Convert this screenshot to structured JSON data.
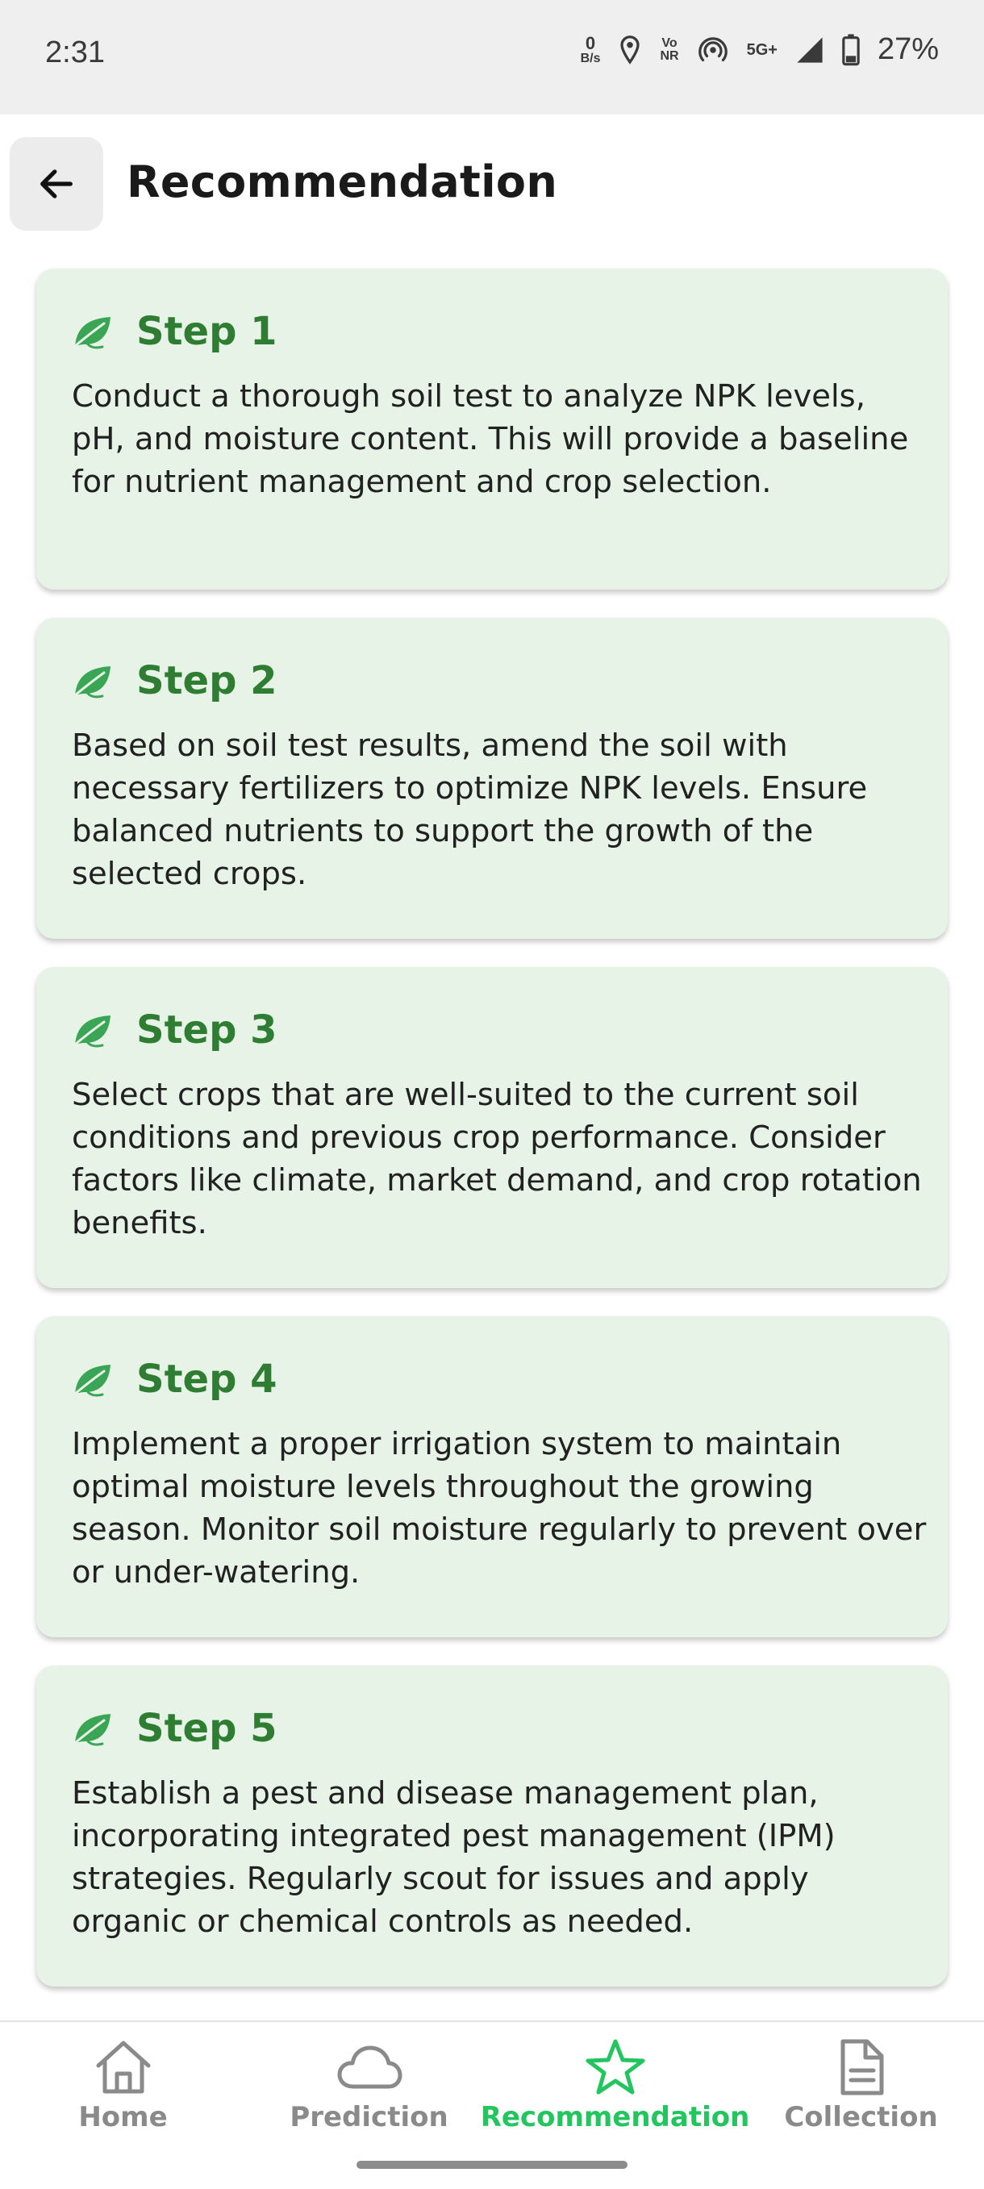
{
  "status_bar": {
    "time": "2:31",
    "data_rate_value": "0",
    "data_rate_unit": "B/s",
    "volte_top": "Vo",
    "volte_bottom": "NR",
    "network": "5G+",
    "battery": "27%"
  },
  "header": {
    "title": "Recommendation"
  },
  "steps": [
    {
      "title": "Step 1",
      "text": "Conduct a thorough soil test to analyze NPK levels, pH, and moisture content. This will provide a baseline for nutrient management and crop selection."
    },
    {
      "title": "Step 2",
      "text": "Based on soil test results, amend the soil with necessary fertilizers to optimize NPK levels. Ensure balanced nutrients to support the growth of the selected crops."
    },
    {
      "title": "Step 3",
      "text": "Select crops that are well-suited to the current soil conditions and previous crop performance. Consider factors like climate, market demand, and crop rotation benefits."
    },
    {
      "title": "Step 4",
      "text": "Implement a proper irrigation system to maintain optimal moisture levels throughout the growing season. Monitor soil moisture regularly to prevent over or under-watering."
    },
    {
      "title": "Step 5",
      "text": "Establish a pest and disease management plan, incorporating integrated pest management (IPM) strategies. Regularly scout for issues and apply organic or chemical controls as needed."
    }
  ],
  "bottom_nav": {
    "items": [
      {
        "label": "Home",
        "icon": "home-icon"
      },
      {
        "label": "Prediction",
        "icon": "cloud-icon"
      },
      {
        "label": "Recommendation",
        "icon": "star-icon",
        "active": true
      },
      {
        "label": "Collection",
        "icon": "document-icon"
      }
    ]
  },
  "colors": {
    "accent": "#22c55e",
    "step_title": "#2e7d32",
    "card_bg": "#e6f3e6",
    "nav_inactive": "#8a8a8a"
  }
}
